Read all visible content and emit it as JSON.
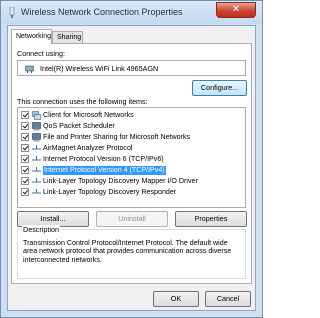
{
  "window": {
    "title": "Wireless Network Connection Properties",
    "close_glyph": "✕"
  },
  "tabs": [
    {
      "label": "Networking",
      "active": true
    },
    {
      "label": "Sharing",
      "active": false
    }
  ],
  "connect_using": {
    "label": "Connect using:",
    "adapter": "Intel(R) Wireless WiFi Link 4965AGN",
    "configure_button": "Configure..."
  },
  "items_label": "This connection uses the following items:",
  "items": [
    {
      "label": "Client for Microsoft Networks",
      "checked": true,
      "icon": "network-client-icon",
      "selected": false
    },
    {
      "label": "QoS Packet Scheduler",
      "checked": true,
      "icon": "service-icon",
      "selected": false
    },
    {
      "label": "File and Printer Sharing for Microsoft Networks",
      "checked": true,
      "icon": "service-icon",
      "selected": false
    },
    {
      "label": "AirMagnet Analyzer Protocol",
      "checked": true,
      "icon": "protocol-icon",
      "selected": false
    },
    {
      "label": "Internet Protocol Version 6 (TCP/IPv6)",
      "checked": true,
      "icon": "protocol-icon",
      "selected": false
    },
    {
      "label": "Internet Protocol Version 4 (TCP/IPv4)",
      "checked": true,
      "icon": "protocol-icon",
      "selected": true
    },
    {
      "label": "Link-Layer Topology Discovery Mapper I/O Driver",
      "checked": true,
      "icon": "protocol-icon",
      "selected": false
    },
    {
      "label": "Link-Layer Topology Discovery Responder",
      "checked": true,
      "icon": "protocol-icon",
      "selected": false
    }
  ],
  "buttons": {
    "install": "Install...",
    "uninstall": "Uninstall",
    "properties": "Properties",
    "ok": "OK",
    "cancel": "Cancel"
  },
  "description": {
    "title": "Description",
    "text": "Transmission Control Protocol/Internet Protocol. The default wide area network protocol that provides communication across diverse interconnected networks."
  },
  "colors": {
    "selection": "#3399ff",
    "close_button": "#c9452f",
    "title_bar": "#cfe0f3"
  }
}
